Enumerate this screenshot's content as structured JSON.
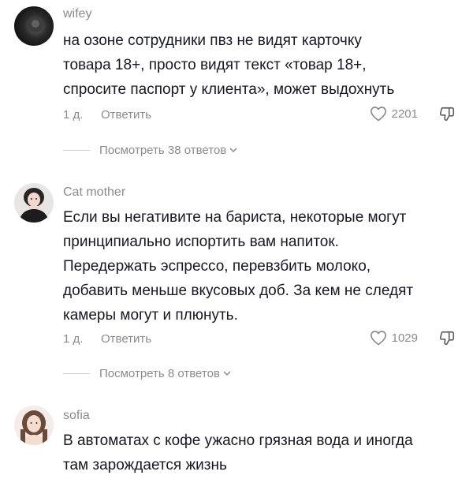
{
  "comments": [
    {
      "username": "wifey",
      "lines": [
        "на озоне сотрудники пвз не видят карточку",
        "товара 18+, просто видят текст «товар 18+,",
        "спросите паспорт у клиента», может выдохнуть"
      ],
      "time": "1 д.",
      "reply_label": "Ответить",
      "likes": "2201",
      "view_replies": "Посмотреть 38 ответов"
    },
    {
      "username": "Cat mother",
      "lines": [
        "Если вы негативите на бариста, некоторые могут",
        "принципиально испортить вам напиток.",
        "Передержать эспрессо, перевзбить молоко,",
        "добавить меньше вкусовых доб. За кем не следят",
        "камеры могут и плюнуть."
      ],
      "time": "1 д.",
      "reply_label": "Ответить",
      "likes": "1029",
      "view_replies": "Посмотреть 8 ответов"
    },
    {
      "username": "sofia",
      "lines": [
        "В автоматах с кофе ужасно грязная вода и иногда",
        "там зарождается жизнь"
      ]
    }
  ],
  "icons": {
    "like": "heart-outline-icon",
    "dislike": "thumbs-down-icon",
    "expand": "chevron-down-icon"
  },
  "colors": {
    "text": "#161823",
    "secondary": "#8a8b91",
    "divider": "#cfd0d3",
    "background": "#ffffff"
  }
}
